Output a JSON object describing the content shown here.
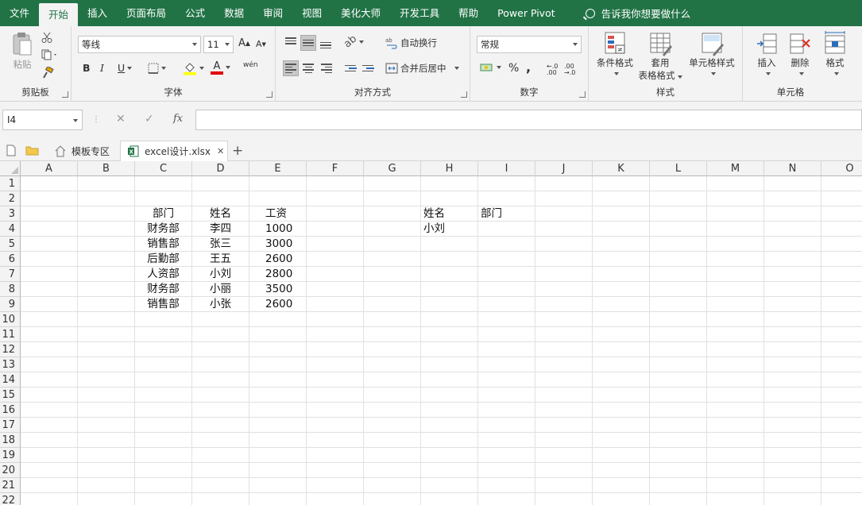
{
  "menu": {
    "tabs": [
      "文件",
      "开始",
      "插入",
      "页面布局",
      "公式",
      "数据",
      "审阅",
      "视图",
      "美化大师",
      "开发工具",
      "帮助",
      "Power Pivot"
    ],
    "active_tab": "开始",
    "tell_me": "告诉我你想要做什么"
  },
  "ribbon": {
    "clipboard": {
      "label": "剪贴板",
      "paste": "粘贴"
    },
    "font": {
      "label": "字体",
      "font_name": "等线",
      "font_size": "11",
      "bold": "B",
      "italic": "I",
      "underline": "U",
      "grow": "A",
      "shrink": "A",
      "phonetic": "wén",
      "font_color_glyph": "A"
    },
    "alignment": {
      "label": "对齐方式",
      "wrap_text": "自动换行",
      "merge_center": "合并后居中"
    },
    "number": {
      "label": "数字",
      "format": "常规",
      "percent": "%",
      "comma": ",",
      "inc_decimal": "←.0 .00",
      "dec_decimal": ".00 →.0"
    },
    "styles": {
      "label": "样式",
      "conditional": "条件格式",
      "table_format_1": "套用",
      "table_format_2": "表格格式",
      "cell_styles": "单元格样式"
    },
    "cells": {
      "label": "单元格",
      "insert": "插入",
      "delete": "删除",
      "format": "格式"
    }
  },
  "formula_bar": {
    "name_box": "I4",
    "cancel": "✕",
    "enter": "✓",
    "fx": "fx",
    "content": ""
  },
  "file_tabs": {
    "templates": "模板专区",
    "workbook": "excel设计.xlsx",
    "close": "✕",
    "new": "+"
  },
  "sheet": {
    "columns": [
      "A",
      "B",
      "C",
      "D",
      "E",
      "F",
      "G",
      "H",
      "I",
      "J",
      "K",
      "L",
      "M",
      "N",
      "O"
    ],
    "rows": [
      "1",
      "2",
      "3",
      "4",
      "5",
      "6",
      "7",
      "8",
      "9",
      "10",
      "11",
      "12",
      "13",
      "14",
      "15",
      "16",
      "17",
      "18",
      "19",
      "20",
      "21",
      "22"
    ],
    "cells": {
      "C3": "部门",
      "D3": "姓名",
      "E3": "工资",
      "C4": "财务部",
      "D4": "李四",
      "E4": "1000",
      "C5": "销售部",
      "D5": "张三",
      "E5": "3000",
      "C6": "后勤部",
      "D6": "王五",
      "E6": "2600",
      "C7": "人资部",
      "D7": "小刘",
      "E7": "2800",
      "C8": "财务部",
      "D8": "小丽",
      "E8": "3500",
      "C9": "销售部",
      "D9": "小张",
      "E9": "2600",
      "H3": "姓名",
      "I3": "部门",
      "H4": "小刘"
    }
  },
  "colors": {
    "brand": "#217346",
    "grid_line": "#e1e1e1",
    "header_bg": "#f3f3f3"
  }
}
